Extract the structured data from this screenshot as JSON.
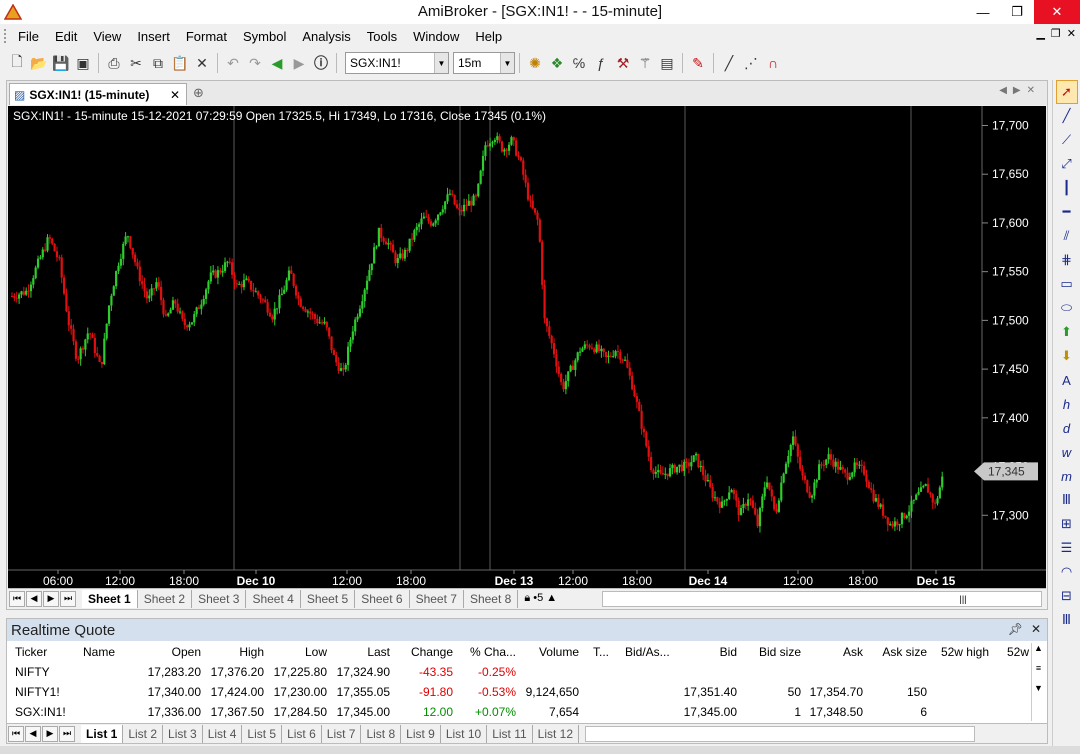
{
  "window": {
    "title": "AmiBroker - [SGX:IN1! -  - 15-minute]",
    "minimize": "—",
    "restore": "❐",
    "close": "✕"
  },
  "menu": [
    "File",
    "Edit",
    "View",
    "Insert",
    "Format",
    "Symbol",
    "Analysis",
    "Tools",
    "Window",
    "Help"
  ],
  "toolbar": {
    "symbol_value": "SGX:IN1!",
    "interval_value": "15m"
  },
  "chart_tab": {
    "label": "SGX:IN1! (15-minute)",
    "close": "✕",
    "add": "⊕"
  },
  "chart_header": "SGX:IN1! - 15-minute 15-12-2021 07:29:59 Open 17325.5, Hi 17349, Lo 17316, Close 17345 (0.1%)",
  "sheets": [
    "Sheet 1",
    "Sheet 2",
    "Sheet 3",
    "Sheet 4",
    "Sheet 5",
    "Sheet 6",
    "Sheet 7",
    "Sheet 8"
  ],
  "chart_data": {
    "type": "candlestick",
    "symbol": "SGX:IN1!",
    "interval": "15-minute",
    "last_value_label": "17,345",
    "ylim": [
      17250,
      17720
    ],
    "y_ticks": [
      17300,
      17350,
      17400,
      17450,
      17500,
      17550,
      17600,
      17650,
      17700
    ],
    "y_tick_labels": [
      "17,300",
      "17,350",
      "17,400",
      "17,450",
      "17,500",
      "17,550",
      "17,600",
      "17,650",
      "17,700"
    ],
    "x_tick_labels": [
      {
        "label": "06:00",
        "bold": false
      },
      {
        "label": "12:00",
        "bold": false
      },
      {
        "label": "18:00",
        "bold": false
      },
      {
        "label": "Dec 10",
        "bold": true
      },
      {
        "label": "12:00",
        "bold": false
      },
      {
        "label": "18:00",
        "bold": false
      },
      {
        "label": "Dec 13",
        "bold": true
      },
      {
        "label": "12:00",
        "bold": false
      },
      {
        "label": "18:00",
        "bold": false
      },
      {
        "label": "Dec 14",
        "bold": true
      },
      {
        "label": "12:00",
        "bold": false
      },
      {
        "label": "18:00",
        "bold": false
      },
      {
        "label": "Dec 15",
        "bold": true
      }
    ],
    "close_path": [
      [
        0,
        17525
      ],
      [
        10,
        17530
      ],
      [
        18,
        17560
      ],
      [
        25,
        17585
      ],
      [
        32,
        17560
      ],
      [
        38,
        17500
      ],
      [
        44,
        17460
      ],
      [
        52,
        17490
      ],
      [
        60,
        17450
      ],
      [
        66,
        17520
      ],
      [
        72,
        17560
      ],
      [
        78,
        17590
      ],
      [
        85,
        17550
      ],
      [
        92,
        17520
      ],
      [
        98,
        17540
      ],
      [
        104,
        17500
      ],
      [
        110,
        17520
      ],
      [
        116,
        17495
      ],
      [
        122,
        17500
      ],
      [
        128,
        17520
      ],
      [
        134,
        17545
      ],
      [
        140,
        17550
      ],
      [
        146,
        17560
      ],
      [
        152,
        17535
      ],
      [
        158,
        17540
      ],
      [
        164,
        17530
      ],
      [
        170,
        17520
      ],
      [
        176,
        17505
      ],
      [
        182,
        17525
      ],
      [
        188,
        17550
      ],
      [
        194,
        17520
      ],
      [
        200,
        17510
      ],
      [
        206,
        17500
      ],
      [
        212,
        17495
      ],
      [
        218,
        17460
      ],
      [
        224,
        17445
      ],
      [
        230,
        17490
      ],
      [
        236,
        17520
      ],
      [
        242,
        17555
      ],
      [
        248,
        17590
      ],
      [
        254,
        17580
      ],
      [
        260,
        17560
      ],
      [
        266,
        17570
      ],
      [
        272,
        17590
      ],
      [
        278,
        17605
      ],
      [
        284,
        17600
      ],
      [
        290,
        17615
      ],
      [
        296,
        17630
      ],
      [
        302,
        17610
      ],
      [
        308,
        17620
      ],
      [
        314,
        17625
      ],
      [
        320,
        17680
      ],
      [
        326,
        17690
      ],
      [
        332,
        17675
      ],
      [
        338,
        17685
      ],
      [
        344,
        17660
      ],
      [
        350,
        17620
      ],
      [
        356,
        17600
      ],
      [
        360,
        17500
      ],
      [
        366,
        17470
      ],
      [
        372,
        17430
      ],
      [
        378,
        17450
      ],
      [
        384,
        17470
      ],
      [
        390,
        17475
      ],
      [
        396,
        17470
      ],
      [
        402,
        17460
      ],
      [
        408,
        17470
      ],
      [
        414,
        17460
      ],
      [
        420,
        17430
      ],
      [
        426,
        17390
      ],
      [
        432,
        17350
      ],
      [
        438,
        17340
      ],
      [
        444,
        17345
      ],
      [
        450,
        17350
      ],
      [
        456,
        17350
      ],
      [
        462,
        17360
      ],
      [
        468,
        17340
      ],
      [
        474,
        17320
      ],
      [
        480,
        17310
      ],
      [
        486,
        17330
      ],
      [
        492,
        17300
      ],
      [
        498,
        17320
      ],
      [
        504,
        17290
      ],
      [
        510,
        17340
      ],
      [
        516,
        17300
      ],
      [
        522,
        17350
      ],
      [
        528,
        17380
      ],
      [
        534,
        17340
      ],
      [
        540,
        17320
      ],
      [
        546,
        17350
      ],
      [
        552,
        17360
      ],
      [
        558,
        17350
      ],
      [
        564,
        17340
      ],
      [
        570,
        17350
      ],
      [
        576,
        17345
      ],
      [
        582,
        17320
      ],
      [
        588,
        17305
      ],
      [
        594,
        17290
      ],
      [
        600,
        17295
      ],
      [
        606,
        17305
      ],
      [
        612,
        17320
      ],
      [
        618,
        17330
      ],
      [
        624,
        17310
      ],
      [
        630,
        17345
      ]
    ]
  },
  "realtime_quote": {
    "title": "Realtime Quote",
    "columns": [
      "Ticker",
      "Name",
      "Open",
      "High",
      "Low",
      "Last",
      "Change",
      "% Cha...",
      "Volume",
      "T...",
      "Bid/As...",
      "Bid",
      "Bid size",
      "Ask",
      "Ask size",
      "52w high",
      "52w"
    ],
    "rows": [
      {
        "ticker": "NIFTY",
        "name": "",
        "open": "17,283.20",
        "high": "17,376.20",
        "low": "17,225.80",
        "last": "17,324.90",
        "change": "-43.35",
        "pct": "-0.25%",
        "volume": "",
        "bid": "",
        "bid_size": "",
        "ask": "",
        "ask_size": "",
        "dir": "neg"
      },
      {
        "ticker": "NIFTY1!",
        "name": "",
        "open": "17,340.00",
        "high": "17,424.00",
        "low": "17,230.00",
        "last": "17,355.05",
        "change": "-91.80",
        "pct": "-0.53%",
        "volume": "9,124,650",
        "bid": "17,351.40",
        "bid_size": "50",
        "ask": "17,354.70",
        "ask_size": "150",
        "dir": "neg"
      },
      {
        "ticker": "SGX:IN1!",
        "name": "",
        "open": "17,336.00",
        "high": "17,367.50",
        "low": "17,284.50",
        "last": "17,345.00",
        "change": "12.00",
        "pct": "+0.07%",
        "volume": "7,654",
        "bid": "17,345.00",
        "bid_size": "1",
        "ask": "17,348.50",
        "ask_size": "6",
        "dir": "pos"
      }
    ],
    "lists": [
      "List 1",
      "List 2",
      "List 3",
      "List 4",
      "List 5",
      "List 6",
      "List 7",
      "List 8",
      "List 9",
      "List 10",
      "List 11",
      "List 12"
    ]
  },
  "colors": {
    "up": "#2ecc2e",
    "down": "#e01010",
    "background": "#000000",
    "grid_session": "#5a5a5a",
    "price_label_bg": "#c8c8c8"
  }
}
